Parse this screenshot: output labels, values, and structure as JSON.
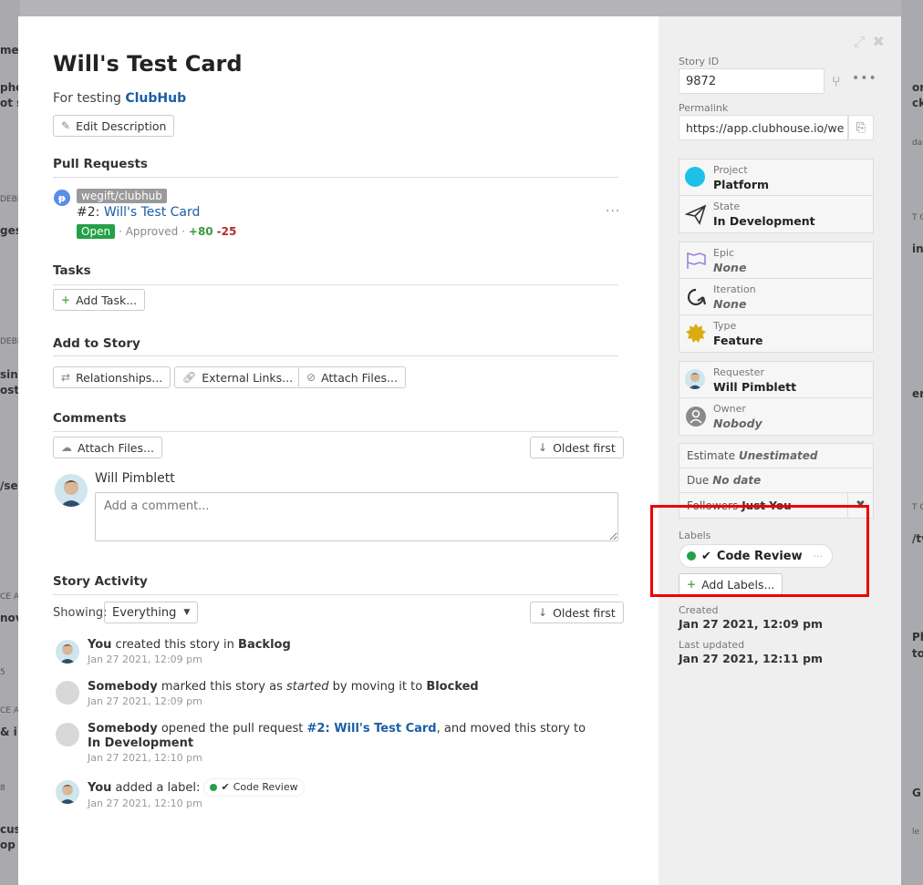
{
  "background": {
    "left_snippets": [
      "me",
      "pho",
      "ot s",
      "DEBIT",
      "ges",
      "DEBIT",
      "sing",
      "oste",
      "/sel",
      "CE A",
      "nov",
      "5",
      "CE A",
      "& i",
      "8",
      "cust",
      "op u"
    ],
    "right_snippets": [
      "or",
      "ck",
      "dat",
      "T C",
      "in",
      "erg",
      "T C",
      "/tw",
      "Ph",
      "to",
      "G",
      "le"
    ]
  },
  "modal": {
    "title": "Will's Test Card",
    "description_prefix": "For testing",
    "description_link": "ClubHub",
    "edit_description": "Edit Description",
    "pull_requests": {
      "heading": "Pull Requests",
      "repo": "wegift/clubhub",
      "number": "#2:",
      "title": "Will's Test Card",
      "status": "Open",
      "approved": "· Approved ·",
      "additions": "+80",
      "deletions": "-25"
    },
    "tasks": {
      "heading": "Tasks",
      "add_task": "Add Task..."
    },
    "add_to_story": {
      "heading": "Add to Story",
      "relationships": "Relationships...",
      "external_links": "External Links...",
      "attach_files": "Attach Files..."
    },
    "comments": {
      "heading": "Comments",
      "attach_files": "Attach Files...",
      "sort": "Oldest first",
      "author": "Will Pimblett",
      "placeholder": "Add a comment..."
    },
    "activity": {
      "heading": "Story Activity",
      "showing_label": "Showing:",
      "filter": "Everything",
      "sort": "Oldest first",
      "items": [
        {
          "actor": "You",
          "text": "created this story in",
          "target": "Backlog",
          "time": "Jan 27 2021, 12:09 pm"
        },
        {
          "actor": "Somebody",
          "text1": "marked this story as",
          "italic": "started",
          "text2": "by moving it to",
          "target": "Blocked",
          "time": "Jan 27 2021, 12:09 pm"
        },
        {
          "actor": "Somebody",
          "text1": "opened the pull request",
          "link": "#2: Will's Test Card",
          "text2": ", and moved this story to",
          "target": "In Development",
          "time": "Jan 27 2021, 12:10 pm"
        },
        {
          "actor": "You",
          "text": "added a label:",
          "label": "Code Review",
          "time": "Jan 27 2021, 12:10 pm"
        }
      ]
    }
  },
  "sidebar": {
    "story_id_label": "Story ID",
    "story_id": "9872",
    "permalink_label": "Permalink",
    "permalink": "https://app.clubhouse.io/we ...",
    "project": {
      "label": "Project",
      "value": "Platform"
    },
    "state": {
      "label": "State",
      "value": "In Development"
    },
    "epic": {
      "label": "Epic",
      "value": "None"
    },
    "iteration": {
      "label": "Iteration",
      "value": "None"
    },
    "type": {
      "label": "Type",
      "value": "Feature"
    },
    "requester": {
      "label": "Requester",
      "value": "Will Pimblett"
    },
    "owner": {
      "label": "Owner",
      "value": "Nobody"
    },
    "estimate": {
      "label": "Estimate",
      "value": "Unestimated"
    },
    "due": {
      "label": "Due",
      "value": "No date"
    },
    "followers": {
      "label": "Followers",
      "value": "Just You"
    },
    "labels_label": "Labels",
    "label_name": "Code Review",
    "add_labels": "Add Labels...",
    "created_label": "Created",
    "created": "Jan 27 2021, 12:09 pm",
    "updated_label": "Last updated",
    "updated": "Jan 27 2021, 12:11 pm"
  },
  "colors": {
    "link": "#1b5ea6",
    "open_badge": "#24a148",
    "project_dot": "#1ec0e8",
    "highlight": "#ee0000"
  }
}
